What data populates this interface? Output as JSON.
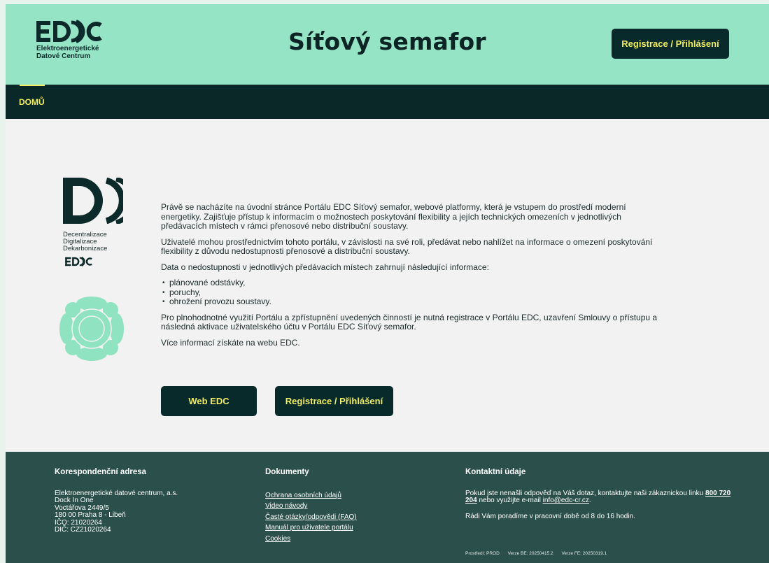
{
  "header": {
    "logo_subtitle_line1": "Elektroenergetické",
    "logo_subtitle_line2": "Datové Centrum",
    "title": "Síťový semafor",
    "login_button": "Registrace / Přihlášení"
  },
  "nav": {
    "items": [
      {
        "label": "DOMŮ"
      }
    ]
  },
  "side": {
    "caption_line1": "Decentralizace",
    "caption_line2": "Digitalizace",
    "caption_line3": "Dekarbonizace"
  },
  "main": {
    "paragraph1": "Právě se nacházíte na úvodní stránce Portálu EDC Síťový semafor, webové platformy, která je vstupem do prostředí moderní energetiky. Zajišťuje přístup k informacím o možnostech poskytování flexibility a jejích technických omezeních v jednotlivých předávacích místech v rámci přenosové nebo distribuční soustavy.",
    "paragraph2": "Uživatelé mohou prostřednictvím tohoto portálu, v závislosti na své roli, předávat nebo nahlížet na informace o omezení poskytování flexibility z důvodu nedostupnosti přenosové a distribuční soustavy.",
    "paragraph3": "Data o nedostupnosti v jednotlivých předávacích místech zahrnují následující informace:",
    "list": [
      "plánované odstávky,",
      "poruchy,",
      "ohrožení provozu soustavy."
    ],
    "paragraph4": "Pro plnohodnotné využití Portálu a zpřístupnění uvedených činností je nutná registrace v Portálu EDC, uzavření Smlouvy o přístupu a následná aktivace uživatelského účtu v Portálu EDC Síťový semafor.",
    "paragraph5": "Více informací získáte na webu EDC.",
    "button_web": "Web EDC",
    "button_login": "Registrace / Přihlášení"
  },
  "footer": {
    "address": {
      "heading": "Korespondenční adresa",
      "lines": [
        "Elektroenergetické datové centrum, a.s.",
        "Dock In One",
        "Voctářova 2449/5",
        "180 00 Praha 8 - Libeň",
        "IČO: 21020264",
        "DIČ: CZ21020264"
      ]
    },
    "documents": {
      "heading": "Dokumenty",
      "links": [
        "Ochrana osobních údajů",
        "Video návody",
        "Časté otázky/odpovědi (FAQ)",
        "Manuál pro uživatele portálu",
        "Cookies"
      ]
    },
    "contact": {
      "heading": "Kontaktní údaje",
      "text_before_phone": "Pokud jste nenašli odpověď na Váš dotaz, kontaktujte naši zákaznickou linku ",
      "phone": "800 720 204",
      "text_before_email": " nebo využijte e-mail ",
      "email": "info@edc-cr.cz",
      "text_after_email": ".",
      "hours": "Rádi Vám poradíme v pracovní době od 8 do 16 hodin."
    },
    "meta": {
      "environment": "Prostředí: PROD",
      "version_be": "Verze BE: 20250415.2",
      "version_fe": "Verze FE: 20250319.1"
    }
  },
  "colors": {
    "header_bg": "#94e4c5",
    "nav_bg": "#0a2828",
    "accent_yellow": "#f1ec60",
    "button_bg": "#082a2a",
    "footer_bg": "#2b504c",
    "flower_green": "#8fe3c0"
  }
}
